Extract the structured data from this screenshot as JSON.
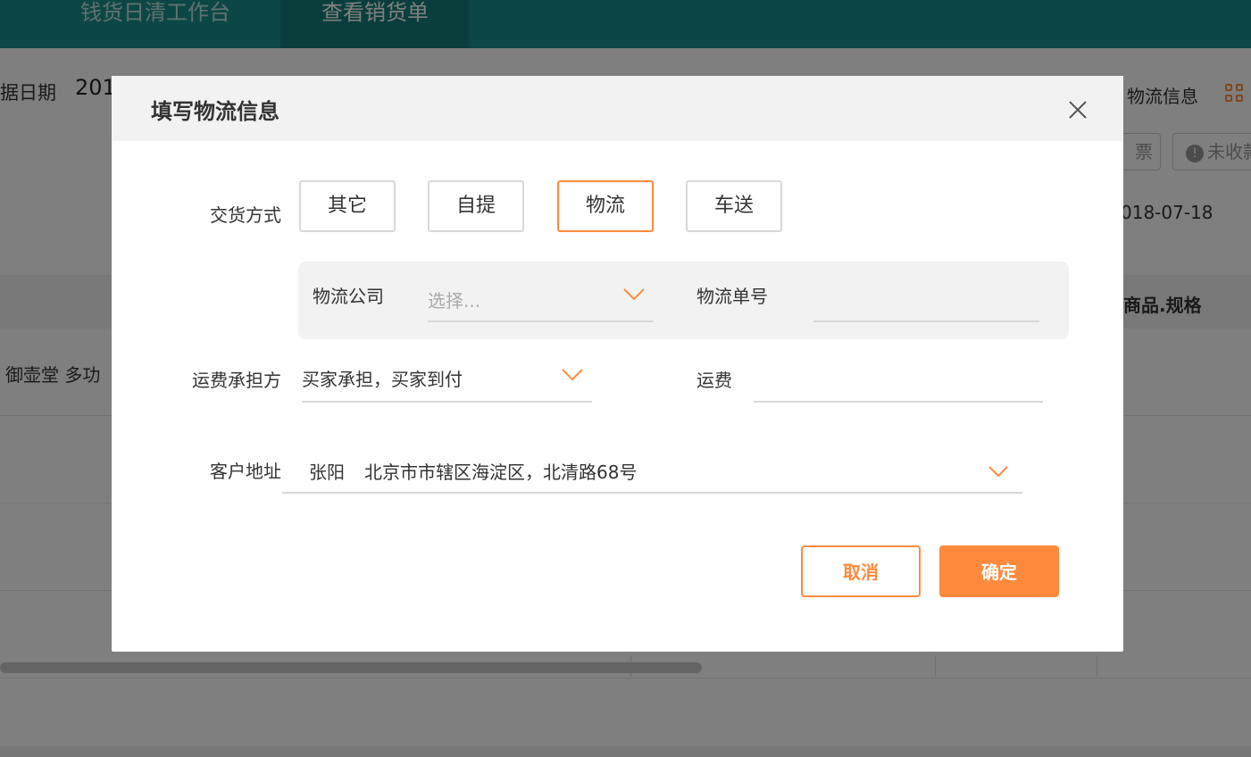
{
  "colors": {
    "accent": "#ff8a3d",
    "topbar": "#1a8f8a",
    "overlay": "rgba(0,0,0,0.5)"
  },
  "topbar": {
    "tabs": [
      {
        "label": "钱货日清工作台"
      },
      {
        "label": "查看销货单"
      }
    ]
  },
  "background": {
    "date_label": "据日期",
    "date_value": "201",
    "logistics_link": "物流信息",
    "ticket_button": "票",
    "unpaid_button": "未收款",
    "date2": "018-07-18",
    "spec_header": "商品.规格",
    "row1_text": "御壶堂 多功"
  },
  "modal": {
    "title": "填写物流信息",
    "close_icon": "close-icon",
    "delivery": {
      "label": "交货方式",
      "options": [
        {
          "label": "其它",
          "active": false
        },
        {
          "label": "自提",
          "active": false
        },
        {
          "label": "物流",
          "active": true
        },
        {
          "label": "车送",
          "active": false
        }
      ]
    },
    "logistics": {
      "company_label": "物流公司",
      "company_placeholder": "选择...",
      "number_label": "物流单号",
      "number_value": ""
    },
    "payer": {
      "label": "运费承担方",
      "value": "买家承担，买家到付"
    },
    "freight": {
      "label": "运费",
      "value": ""
    },
    "address": {
      "label": "客户地址",
      "name": "张阳",
      "address": "北京市市辖区海淀区，北清路68号"
    },
    "buttons": {
      "cancel": "取消",
      "ok": "确定"
    }
  }
}
